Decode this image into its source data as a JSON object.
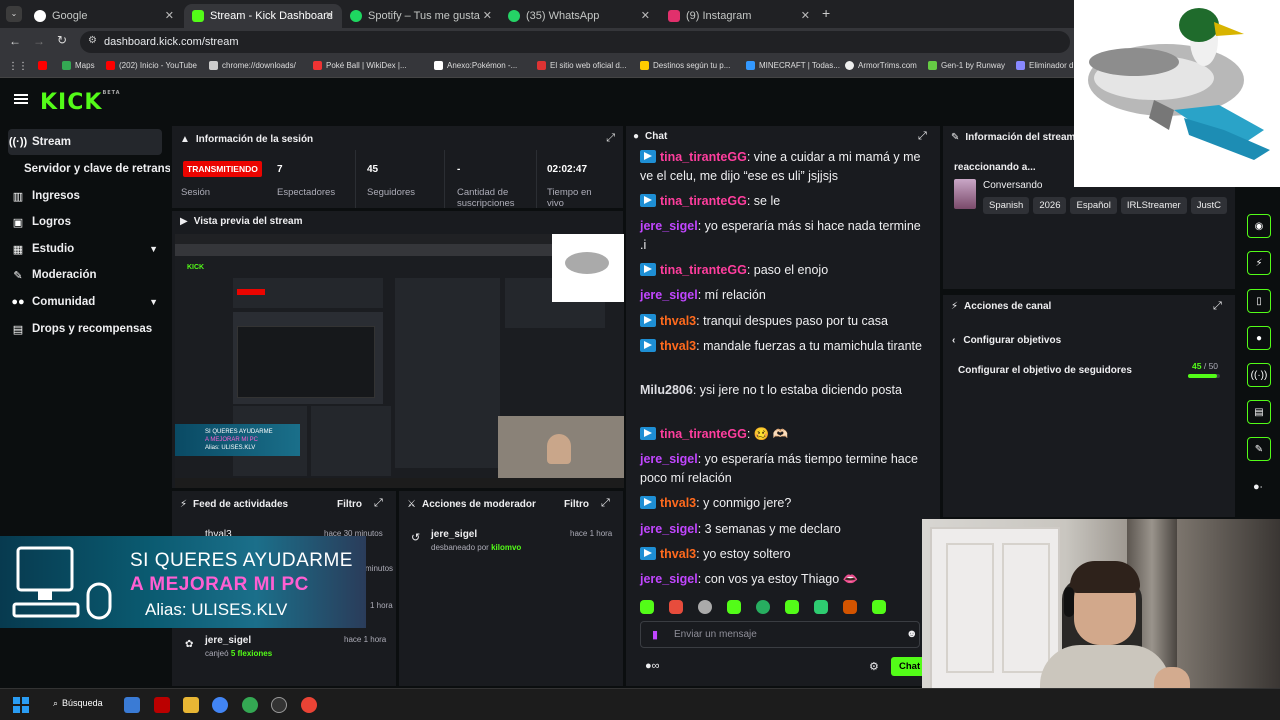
{
  "browser": {
    "tabs": [
      {
        "title": "Google",
        "color": "#4285f4"
      },
      {
        "title": "Stream - Kick Dashboard",
        "color": "#53fc18"
      },
      {
        "title": "Spotify – Tus me gusta",
        "color": "#1ed760"
      },
      {
        "title": "(35) WhatsApp",
        "color": "#25d366"
      },
      {
        "title": "(9) Instagram",
        "color": "#e1306c"
      }
    ],
    "url": "dashboard.kick.com/stream",
    "bookmarks": [
      "Maps",
      "(202) Inicio - YouTube",
      "chrome://downloads/",
      "Poké Ball | WikiDex |...",
      "Anexo:Pokémon -...",
      "El sitio web oficial d...",
      "Destinos según tu p...",
      "MINECRAFT | Todas...",
      "ArmorTrims.com",
      "Gen-1 by Runway",
      "Eliminador d"
    ]
  },
  "kick": {
    "logo": "KICK",
    "logo_sup": "BETA"
  },
  "sidebar": {
    "items": [
      {
        "label": "Stream",
        "icon": "broadcast-icon"
      },
      {
        "label": "Servidor y clave de retransmisión",
        "icon": ""
      },
      {
        "label": "Ingresos",
        "icon": "bank-icon"
      },
      {
        "label": "Logros",
        "icon": "trophy-icon"
      },
      {
        "label": "Estudio",
        "icon": "studio-icon"
      },
      {
        "label": "Moderación",
        "icon": "wrench-icon"
      },
      {
        "label": "Comunidad",
        "icon": "people-icon"
      },
      {
        "label": "Drops y recompensas",
        "icon": "drops-icon"
      }
    ]
  },
  "session": {
    "title": "Información de la sesión",
    "live_badge": "TRANSMITIENDO",
    "session_label": "Sesión",
    "stats": [
      {
        "value": "7",
        "label": "Espectadores"
      },
      {
        "value": "45",
        "label": "Seguidores"
      },
      {
        "value": "-",
        "label": "Cantidad de suscripciones"
      },
      {
        "value": "02:02:47",
        "label": "Tiempo en vivo"
      }
    ]
  },
  "preview": {
    "title": "Vista previa del stream"
  },
  "feed": {
    "title": "Feed de actividades",
    "filter": "Filtro",
    "items": [
      {
        "user": "thval3",
        "time": "hace 30 minutos"
      },
      {
        "user": "",
        "time": "minutos"
      },
      {
        "user": "",
        "time": "1 hora"
      },
      {
        "user": "jere_sigel",
        "action": "canjeó",
        "reward": "5 flexiones",
        "time": "hace 1 hora"
      }
    ]
  },
  "modactions": {
    "title": "Acciones de moderador",
    "filter": "Filtro",
    "items": [
      {
        "user": "jere_sigel",
        "action": "desbaneado por",
        "by": "kilomvo",
        "time": "hace 1 hora"
      }
    ]
  },
  "chat": {
    "title": "Chat",
    "messages": [
      {
        "user": "tina_tiranteGG",
        "color": "pink",
        "badge": true,
        "text": "vine a cuidar a mi mamá y me ve el celu, me dijo “ese es uli” jsjjsjs"
      },
      {
        "user": "tina_tiranteGG",
        "color": "pink",
        "badge": true,
        "text": "se le"
      },
      {
        "user": "jere_sigel",
        "color": "purple",
        "badge": false,
        "text": "yo esperaría más si hace nada termine .i"
      },
      {
        "user": "tina_tiranteGG",
        "color": "pink",
        "badge": true,
        "text": "paso el enojo"
      },
      {
        "user": "jere_sigel",
        "color": "purple",
        "badge": false,
        "text": "mí relación"
      },
      {
        "user": "thval3",
        "color": "orange",
        "badge": true,
        "text": "tranqui despues paso por tu casa"
      },
      {
        "user": "thval3",
        "color": "orange",
        "badge": true,
        "text": "mandale fuerzas a tu mamichula tirante"
      },
      {
        "user": "Milu2806",
        "color": "gray",
        "badge": false,
        "text": "ysi jere no t lo estaba diciendo posta"
      },
      {
        "user": "tina_tiranteGG",
        "color": "pink",
        "badge": true,
        "text": "🥴 🫶🏻"
      },
      {
        "user": "jere_sigel",
        "color": "purple",
        "badge": false,
        "text": "yo esperaría más tiempo termine hace poco mí relación"
      },
      {
        "user": "thval3",
        "color": "orange",
        "badge": true,
        "text": "y conmigo jere?"
      },
      {
        "user": "jere_sigel",
        "color": "purple",
        "badge": false,
        "text": "3 semanas y me declaro"
      },
      {
        "user": "thval3",
        "color": "orange",
        "badge": true,
        "text": "yo estoy soltero"
      },
      {
        "user": "jere_sigel",
        "color": "purple",
        "badge": false,
        "text": "con vos ya estoy Thiago 👄"
      }
    ],
    "input_placeholder": "Enviar un mensaje",
    "send_label": "Chat"
  },
  "streaminfo": {
    "title": "Información del stream",
    "stream_title": "reaccionando a...",
    "category": "Conversando",
    "tags": [
      "Spanish",
      "2026",
      "Español",
      "IRLStreamer",
      "JustC"
    ]
  },
  "channel_actions": {
    "title": "Acciones de canal",
    "back_label": "Configurar objetivos",
    "goal_label": "Configurar el objetivo de seguidores",
    "goal_current": "45",
    "goal_total": "50",
    "goal_fraction": 0.9
  },
  "overlay": {
    "line1": "SI QUERES AYUDARME",
    "line2": "A MEJORAR MI PC",
    "line3": "Alias: ULISES.KLV"
  },
  "taskbar": {
    "search": "Búsqueda"
  }
}
